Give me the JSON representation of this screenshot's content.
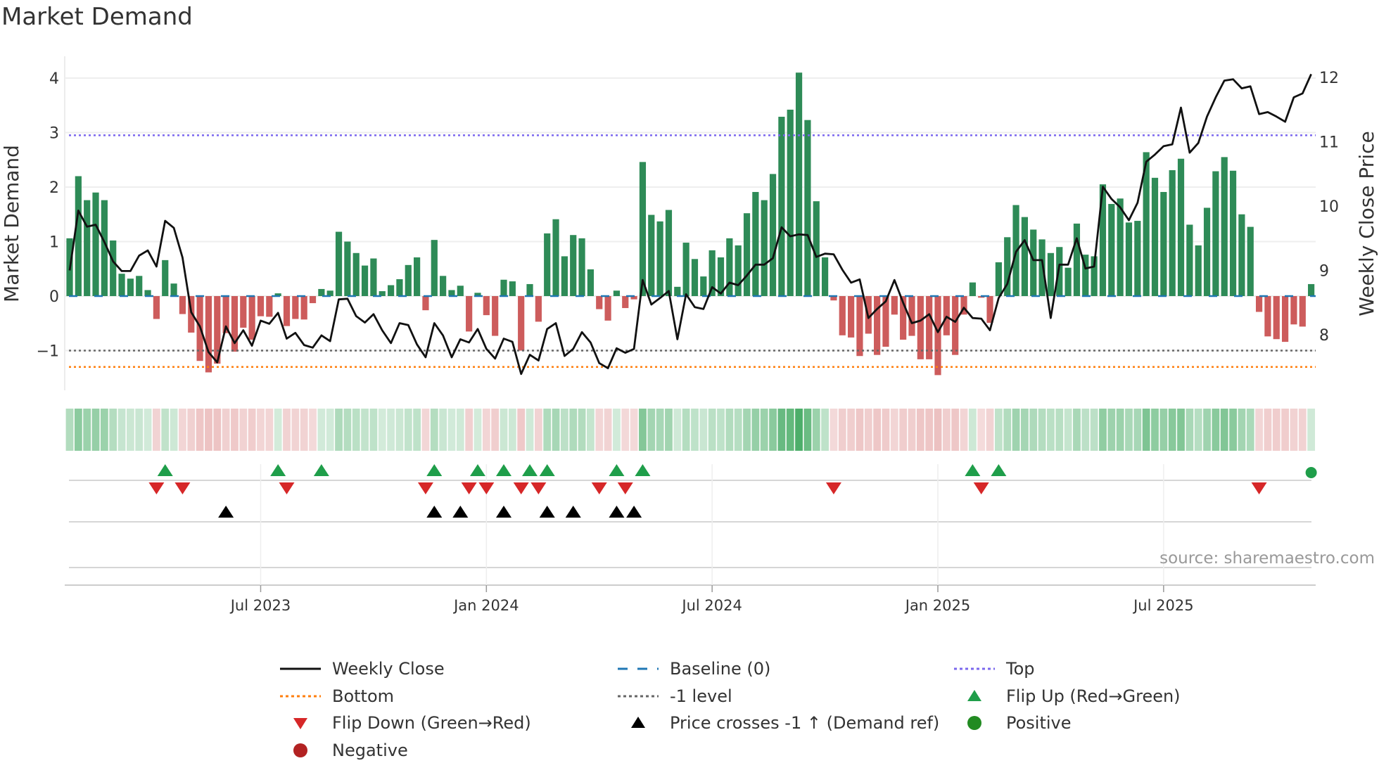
{
  "title": "Market Demand",
  "source": "source: sharemaestro.com",
  "chart_data": {
    "type": "bar",
    "title": "Market Demand",
    "ylabel": "Market Demand",
    "y2label": "Weekly Close Price",
    "ylim": [
      -1.9,
      4.4
    ],
    "y2lim": [
      7.2,
      12.2
    ],
    "yticks": [
      {
        "v": 4,
        "label": "4"
      },
      {
        "v": 3,
        "label": "3"
      },
      {
        "v": 2,
        "label": "2"
      },
      {
        "v": 1,
        "label": "1"
      },
      {
        "v": 0,
        "label": "0"
      },
      {
        "v": -1,
        "label": "−1"
      }
    ],
    "y2ticks": [
      {
        "v": 12,
        "label": "12"
      },
      {
        "v": 11,
        "label": "11"
      },
      {
        "v": 10,
        "label": "10"
      },
      {
        "v": 9,
        "label": "9"
      },
      {
        "v": 8,
        "label": "8"
      }
    ],
    "xticks": [
      {
        "week": 22,
        "label": "Jul 2023"
      },
      {
        "week": 48,
        "label": "Jan 2024"
      },
      {
        "week": 74,
        "label": "Jul 2024"
      },
      {
        "week": 100,
        "label": "Jan 2025"
      },
      {
        "week": 126,
        "label": "Jul 2025"
      }
    ],
    "levels": {
      "top": 2.95,
      "bottom": -1.3,
      "minus_one": -1,
      "baseline": 0
    },
    "demand": [
      1.06,
      2.2,
      1.76,
      1.9,
      1.76,
      1.02,
      0.41,
      0.32,
      0.37,
      0.11,
      -0.42,
      0.66,
      0.23,
      -0.33,
      -0.67,
      -1.19,
      -1.4,
      -1.24,
      -0.68,
      -1.02,
      -0.58,
      -0.8,
      -0.37,
      -0.38,
      0.05,
      -0.55,
      -0.42,
      -0.43,
      -0.13,
      0.13,
      0.1,
      1.18,
      1.0,
      0.79,
      0.56,
      0.69,
      0.09,
      0.2,
      0.31,
      0.57,
      0.71,
      -0.26,
      1.03,
      0.37,
      0.11,
      0.19,
      -0.65,
      0.06,
      -0.35,
      -0.73,
      0.3,
      0.27,
      -1.0,
      0.22,
      -0.47,
      1.15,
      1.41,
      0.73,
      1.12,
      1.06,
      0.49,
      -0.24,
      -0.45,
      0.1,
      -0.22,
      -0.06,
      2.46,
      1.49,
      1.37,
      1.58,
      0.17,
      0.98,
      0.68,
      0.36,
      0.84,
      0.71,
      1.06,
      0.93,
      1.52,
      1.91,
      1.76,
      2.24,
      3.29,
      3.42,
      4.1,
      3.23,
      1.74,
      0.71,
      -0.08,
      -0.72,
      -0.76,
      -1.1,
      -0.69,
      -1.08,
      -0.93,
      -0.34,
      -0.8,
      -0.73,
      -1.16,
      -1.16,
      -1.45,
      -0.72,
      -1.08,
      -0.34,
      0.25,
      -0.03,
      -0.49,
      0.62,
      1.08,
      1.67,
      1.45,
      1.22,
      1.04,
      0.79,
      0.9,
      0.52,
      1.33,
      0.76,
      0.73,
      2.05,
      1.69,
      1.79,
      1.35,
      1.38,
      2.64,
      2.17,
      1.91,
      2.31,
      2.52,
      1.31,
      0.93,
      1.62,
      2.29,
      2.55,
      2.3,
      1.5,
      1.27,
      -0.29,
      -0.74,
      -0.79,
      -0.84,
      -0.52,
      -0.56,
      0.22
    ],
    "price": [
      9.0,
      9.93,
      9.68,
      9.71,
      9.44,
      9.14,
      8.99,
      8.99,
      9.23,
      9.31,
      9.06,
      9.77,
      9.66,
      9.2,
      8.35,
      8.13,
      7.73,
      7.57,
      8.13,
      7.87,
      8.07,
      7.83,
      8.22,
      8.17,
      8.34,
      7.94,
      8.03,
      7.84,
      7.8,
      7.99,
      7.9,
      8.55,
      8.56,
      8.29,
      8.19,
      8.32,
      8.07,
      7.87,
      8.18,
      8.15,
      7.85,
      7.65,
      8.18,
      7.99,
      7.65,
      7.93,
      7.88,
      8.09,
      7.78,
      7.63,
      7.94,
      7.89,
      7.39,
      7.69,
      7.6,
      8.09,
      8.18,
      7.67,
      7.78,
      8.04,
      7.88,
      7.56,
      7.48,
      7.79,
      7.72,
      7.78,
      8.85,
      8.47,
      8.57,
      8.68,
      7.93,
      8.63,
      8.43,
      8.4,
      8.74,
      8.64,
      8.81,
      8.77,
      8.92,
      9.09,
      9.09,
      9.19,
      9.67,
      9.53,
      9.56,
      9.55,
      9.21,
      9.26,
      9.25,
      9.01,
      8.81,
      8.86,
      8.26,
      8.4,
      8.52,
      8.85,
      8.5,
      8.18,
      8.22,
      8.32,
      8.04,
      8.28,
      8.2,
      8.42,
      8.26,
      8.25,
      8.07,
      8.57,
      8.79,
      9.29,
      9.47,
      9.16,
      9.16,
      8.26,
      9.09,
      9.09,
      9.5,
      9.03,
      9.06,
      10.3,
      10.11,
      9.98,
      9.78,
      10.05,
      10.69,
      10.8,
      10.93,
      10.96,
      11.53,
      10.83,
      10.98,
      11.39,
      11.69,
      11.95,
      11.97,
      11.83,
      11.86,
      11.43,
      11.46,
      11.39,
      11.31,
      11.69,
      11.75,
      12.05
    ],
    "flip_up_weeks": [
      11,
      24,
      29,
      42,
      47,
      50,
      53,
      55,
      63,
      66,
      104,
      107
    ],
    "flip_down_weeks": [
      10,
      13,
      25,
      41,
      46,
      48,
      52,
      54,
      61,
      64,
      88,
      105,
      137
    ],
    "price_cross_weeks": [
      18,
      42,
      45,
      50,
      55,
      58,
      63,
      65
    ],
    "positive_weeks": [
      143
    ],
    "legend": [
      {
        "key": "weekly_close",
        "label": "Weekly Close"
      },
      {
        "key": "baseline",
        "label": "Baseline (0)"
      },
      {
        "key": "top",
        "label": "Top"
      },
      {
        "key": "bottom",
        "label": "Bottom"
      },
      {
        "key": "minus_one",
        "label": "-1 level"
      },
      {
        "key": "flip_up",
        "label": "Flip Up (Red→Green)"
      },
      {
        "key": "flip_down",
        "label": "Flip Down (Green→Red)"
      },
      {
        "key": "price_cross",
        "label": "Price crosses -1 ↑ (Demand ref)"
      },
      {
        "key": "positive",
        "label": "Positive"
      },
      {
        "key": "negative",
        "label": "Negative"
      }
    ],
    "colors": {
      "positive_bar": "#2e8b57",
      "negative_bar": "#cd5c5c",
      "price_line": "#111111",
      "baseline": "#1f77b4",
      "top": "#7b68ee",
      "bottom": "#ff7f0e",
      "minus_one": "#666666",
      "flip_up": "#1f9e4a",
      "flip_down": "#d62728",
      "price_cross": "#000000",
      "positive": "#228b22",
      "negative": "#b22222"
    }
  }
}
